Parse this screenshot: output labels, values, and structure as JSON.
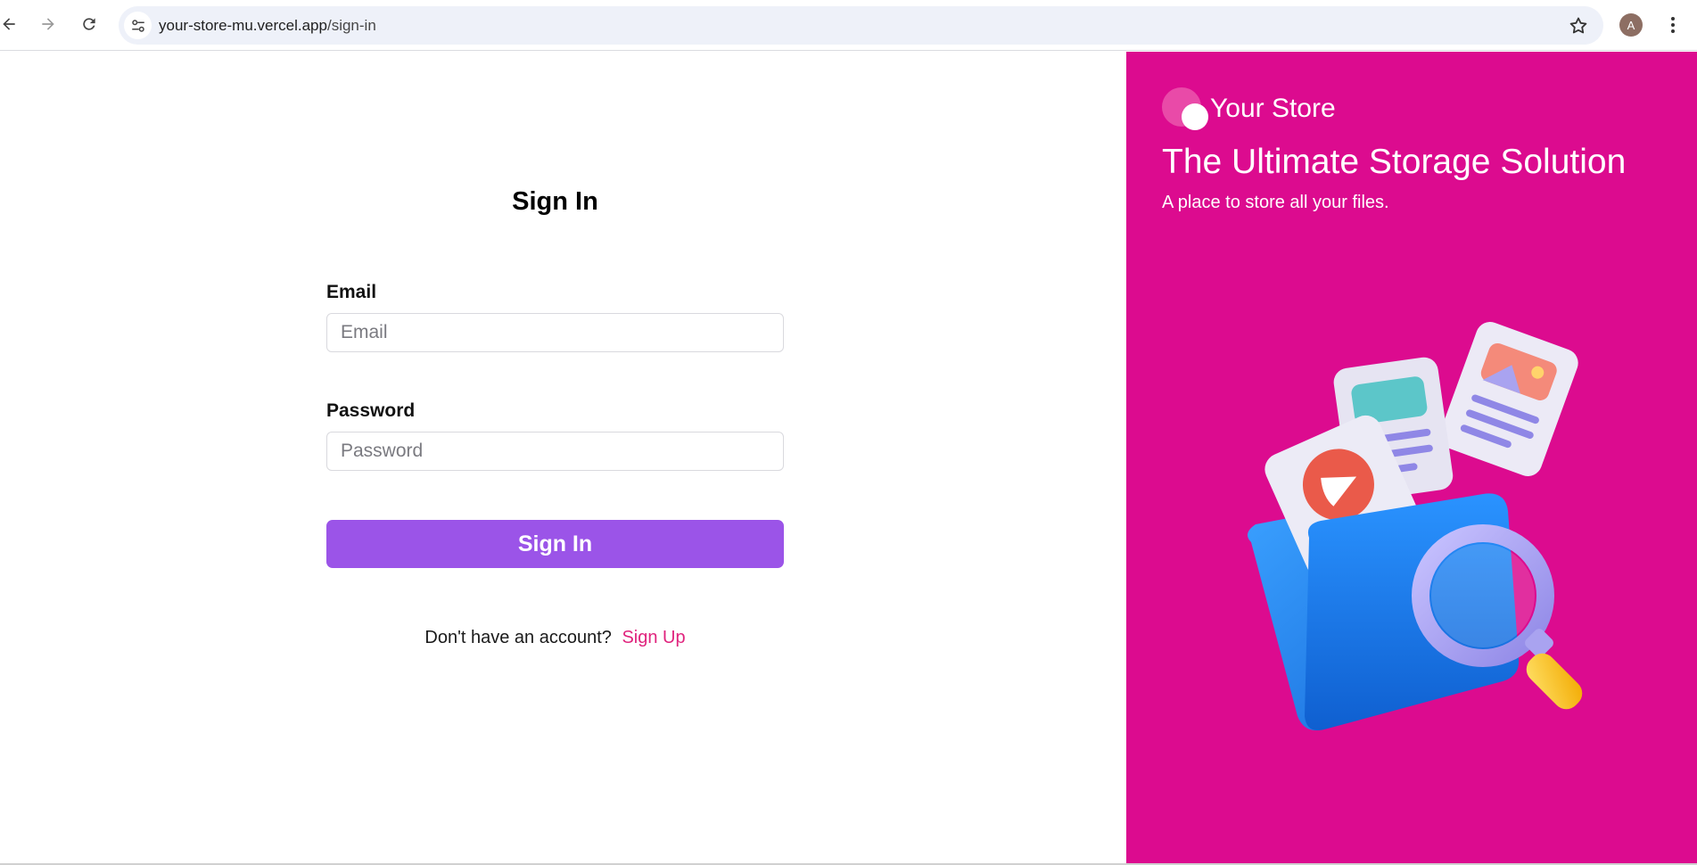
{
  "browser": {
    "url_host": "your-store-mu.vercel.app",
    "url_path": "/sign-in",
    "avatar_letter": "A",
    "icons": [
      "back-arrow-icon",
      "forward-arrow-icon",
      "reload-icon",
      "site-settings-icon",
      "bookmark-star-icon",
      "kebab-menu-icon"
    ]
  },
  "signin": {
    "title": "Sign In",
    "email_label": "Email",
    "email_placeholder": "Email",
    "email_value": "",
    "password_label": "Password",
    "password_placeholder": "Password",
    "password_value": "",
    "submit_label": "Sign In",
    "signup_prompt": "Don't have an account?",
    "signup_link": "Sign Up"
  },
  "brand": {
    "name": "Your Store",
    "headline": "The Ultimate Storage Solution",
    "subtitle": "A place to store all your files."
  },
  "colors": {
    "brand_panel": "#dc0b8f",
    "primary_button": "#9b54e8",
    "link": "#e0237d",
    "folder": "#1e88f5"
  }
}
